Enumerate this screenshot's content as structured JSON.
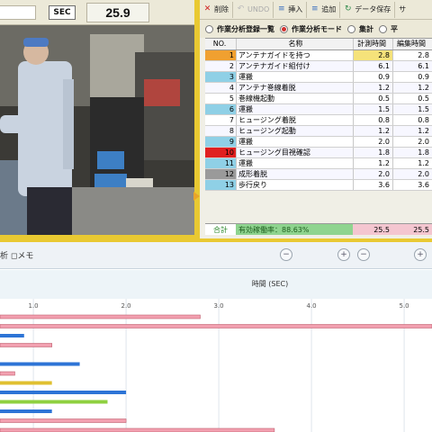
{
  "timer": {
    "sec_label": "SEC",
    "value": "25.9"
  },
  "toolbar": {
    "delete": "削除",
    "undo": "UNDO",
    "insert": "挿入",
    "add": "追加",
    "save": "データ保存",
    "more": "サ"
  },
  "modes": [
    {
      "label": "作業分析登録一覧",
      "selected": false
    },
    {
      "label": "作業分析モード",
      "selected": true
    },
    {
      "label": "集計",
      "selected": false
    },
    {
      "label": "平",
      "selected": false
    }
  ],
  "table": {
    "headers": {
      "no": "NO.",
      "name": "名称",
      "t1": "計測時間",
      "t2": "編集時間"
    },
    "rows": [
      {
        "no": "1",
        "name": "アンテナガイドを持つ",
        "t1": "2.8",
        "t2": "2.8",
        "color": "#f0a030"
      },
      {
        "no": "2",
        "name": "アンテナガイド組付け",
        "t1": "6.1",
        "t2": "6.1",
        "color": ""
      },
      {
        "no": "3",
        "name": "運搬",
        "t1": "0.9",
        "t2": "0.9",
        "color": "#8fd0e6"
      },
      {
        "no": "4",
        "name": "アンテナ巻線着脱",
        "t1": "1.2",
        "t2": "1.2",
        "color": ""
      },
      {
        "no": "5",
        "name": "巻線機起動",
        "t1": "0.5",
        "t2": "0.5",
        "color": ""
      },
      {
        "no": "6",
        "name": "運搬",
        "t1": "1.5",
        "t2": "1.5",
        "color": "#8fd0e6"
      },
      {
        "no": "7",
        "name": "ヒュージング着脱",
        "t1": "0.8",
        "t2": "0.8",
        "color": ""
      },
      {
        "no": "8",
        "name": "ヒュージング起動",
        "t1": "1.2",
        "t2": "1.2",
        "color": ""
      },
      {
        "no": "9",
        "name": "運搬",
        "t1": "2.0",
        "t2": "2.0",
        "color": "#8fd0e6"
      },
      {
        "no": "10",
        "name": "ヒュージング目視確認",
        "t1": "1.8",
        "t2": "1.8",
        "color": "#e02020"
      },
      {
        "no": "11",
        "name": "運搬",
        "t1": "1.2",
        "t2": "1.2",
        "color": "#8fd0e6"
      },
      {
        "no": "12",
        "name": "成形着脱",
        "t1": "2.0",
        "t2": "2.0",
        "color": "#9a9a9a"
      },
      {
        "no": "13",
        "name": "歩行戻り",
        "t1": "3.6",
        "t2": "3.6",
        "color": "#8fd0e6"
      }
    ],
    "total": {
      "label": "合計",
      "efficiency": "有効稼働率：88.63%",
      "t1": "25.5",
      "t2": "25.5"
    }
  },
  "bottom": {
    "memo": "析  ◻メモ",
    "minus": "−",
    "plus": "+"
  },
  "chart_data": {
    "type": "bar",
    "xlabel": "時間 (SEC)",
    "ticks": [
      "1.0",
      "2.0",
      "3.0",
      "4.0",
      "5.0"
    ],
    "xlim": [
      0.6,
      5.3
    ],
    "bars": [
      {
        "value": 2.8,
        "color": "#f2a0b0"
      },
      {
        "value": 6.1,
        "color": "#f2a0b0"
      },
      {
        "value": 0.9,
        "color": "#2d74d6"
      },
      {
        "value": 1.2,
        "color": "#f2a0b0"
      },
      {
        "value": 0.5,
        "color": "#f2a0b0"
      },
      {
        "value": 1.5,
        "color": "#2d74d6"
      },
      {
        "value": 0.8,
        "color": "#f2a0b0"
      },
      {
        "value": 1.2,
        "color": "#e0c030"
      },
      {
        "value": 2.0,
        "color": "#2d74d6"
      },
      {
        "value": 1.8,
        "color": "#8fd040"
      },
      {
        "value": 1.2,
        "color": "#2d74d6"
      },
      {
        "value": 2.0,
        "color": "#f2a0b0"
      },
      {
        "value": 3.6,
        "color": "#f2a0b0"
      }
    ]
  }
}
